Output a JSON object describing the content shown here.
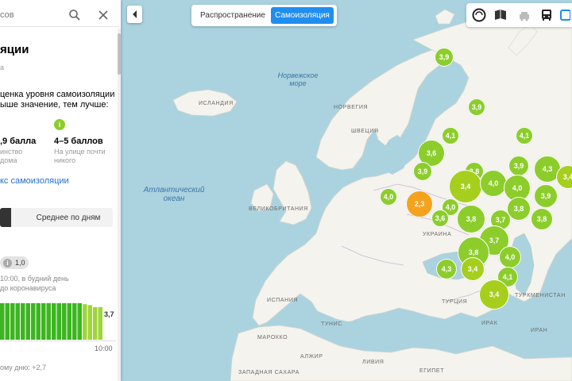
{
  "sidebar": {
    "search_text": "сов",
    "title": "яции",
    "subtitle": "а",
    "description": "ценка уровня самоизоляции\nыше значение, тем лучше:",
    "legend_left_value": "‚9 балла",
    "legend_left_desc": "инство\nдома",
    "legend_right_icon": "i",
    "legend_right_value": "4–5 баллов",
    "legend_right_desc": "На улице почти\nникого",
    "index_link": "кс самоизоляции",
    "tab_avg_label": "Среднее по дням",
    "badge_value": "1,0",
    "time_note": "10:00, в будний день\nдо коронавируса",
    "chart_last_value": "3,7",
    "chart_time_label": "10:00",
    "bottom_note": "ому дню: +2,7"
  },
  "mode_switch": {
    "spread_label": "Распространение",
    "self_isolation_label": "Самоизоляция"
  },
  "map_labels": {
    "countries": [
      "ИСЛАНДИЯ",
      "НОРВЕГИЯ",
      "ШВЕЦИЯ",
      "ВЕЛИКОБРИТАНИЯ",
      "УКРАИНА",
      "ИСПАНИЯ",
      "ТУРЦИЯ",
      "ТУНИС",
      "МАРОККО",
      "АЛЖИР",
      "ЛИВИЯ",
      "ЕГИПЕТ",
      "ИРАК",
      "ИРАН",
      "ТУРКМЕНИСТАН",
      "ЗАПАДНАЯ САХАРА"
    ],
    "norwegian_sea": "Норвежское\nморе",
    "atlantic_ocean": "Атлантический\nокеан"
  },
  "bubbles": [
    {
      "value": "3,9",
      "color": "#8ccd2c"
    },
    {
      "value": "3,9",
      "color": "#8ccd2c"
    },
    {
      "value": "4,1",
      "color": "#8ccd2c"
    },
    {
      "value": "4,1",
      "color": "#8ccd2c"
    },
    {
      "value": "3,6",
      "color": "#8ccd2c"
    },
    {
      "value": "3,9",
      "color": "#8ccd2c"
    },
    {
      "value": "3,8",
      "color": "#8ccd2c"
    },
    {
      "value": "3,9",
      "color": "#8ccd2c"
    },
    {
      "value": "4,3",
      "color": "#8ccd2c"
    },
    {
      "value": "3,4",
      "color": "#a6cf1d"
    },
    {
      "value": "4,0",
      "color": "#8ccd2c"
    },
    {
      "value": "4,0",
      "color": "#8ccd2c"
    },
    {
      "value": "3,9",
      "color": "#8ccd2c"
    },
    {
      "value": "3,4",
      "color": "#a6cf1d"
    },
    {
      "value": "4,0",
      "color": "#8ccd2c"
    },
    {
      "value": "2,3",
      "color": "#f5a21f"
    },
    {
      "value": "4,0",
      "color": "#8ccd2c"
    },
    {
      "value": "3,6",
      "color": "#8ccd2c"
    },
    {
      "value": "3,8",
      "color": "#8ccd2c"
    },
    {
      "value": "3,7",
      "color": "#8ccd2c"
    },
    {
      "value": "3,8",
      "color": "#8ccd2c"
    },
    {
      "value": "3,8",
      "color": "#8ccd2c"
    },
    {
      "value": "3,7",
      "color": "#8ccd2c"
    },
    {
      "value": "3,8",
      "color": "#8ccd2c"
    },
    {
      "value": "4,0",
      "color": "#8ccd2c"
    },
    {
      "value": "4,3",
      "color": "#8ccd2c"
    },
    {
      "value": "3,4",
      "color": "#a6cf1d"
    },
    {
      "value": "4,1",
      "color": "#8ccd2c"
    },
    {
      "value": "3,4",
      "color": "#a6cf1d"
    }
  ],
  "chart_data": {
    "type": "bar",
    "values": [
      3.7,
      3.7,
      3.7,
      3.7,
      3.7,
      3.7,
      3.7,
      3.7,
      3.7,
      3.7,
      3.7,
      3.7,
      3.7,
      3.7,
      3.7,
      3.7,
      3.6,
      3.5,
      3.3,
      3.3
    ],
    "ylim": [
      0,
      4.5
    ],
    "title": "",
    "xlabel": "",
    "ylabel": ""
  },
  "colors": {
    "sea": "#aad3df",
    "land": "#f4f3ed",
    "accent": "#1f8ef1",
    "bubble_green": "#8ccd2c",
    "bubble_orange": "#f5a21f"
  },
  "toolbar_icons": [
    "circle-logo-icon",
    "book-icon",
    "traffic-icon",
    "bus-icon",
    "layers-icon"
  ]
}
